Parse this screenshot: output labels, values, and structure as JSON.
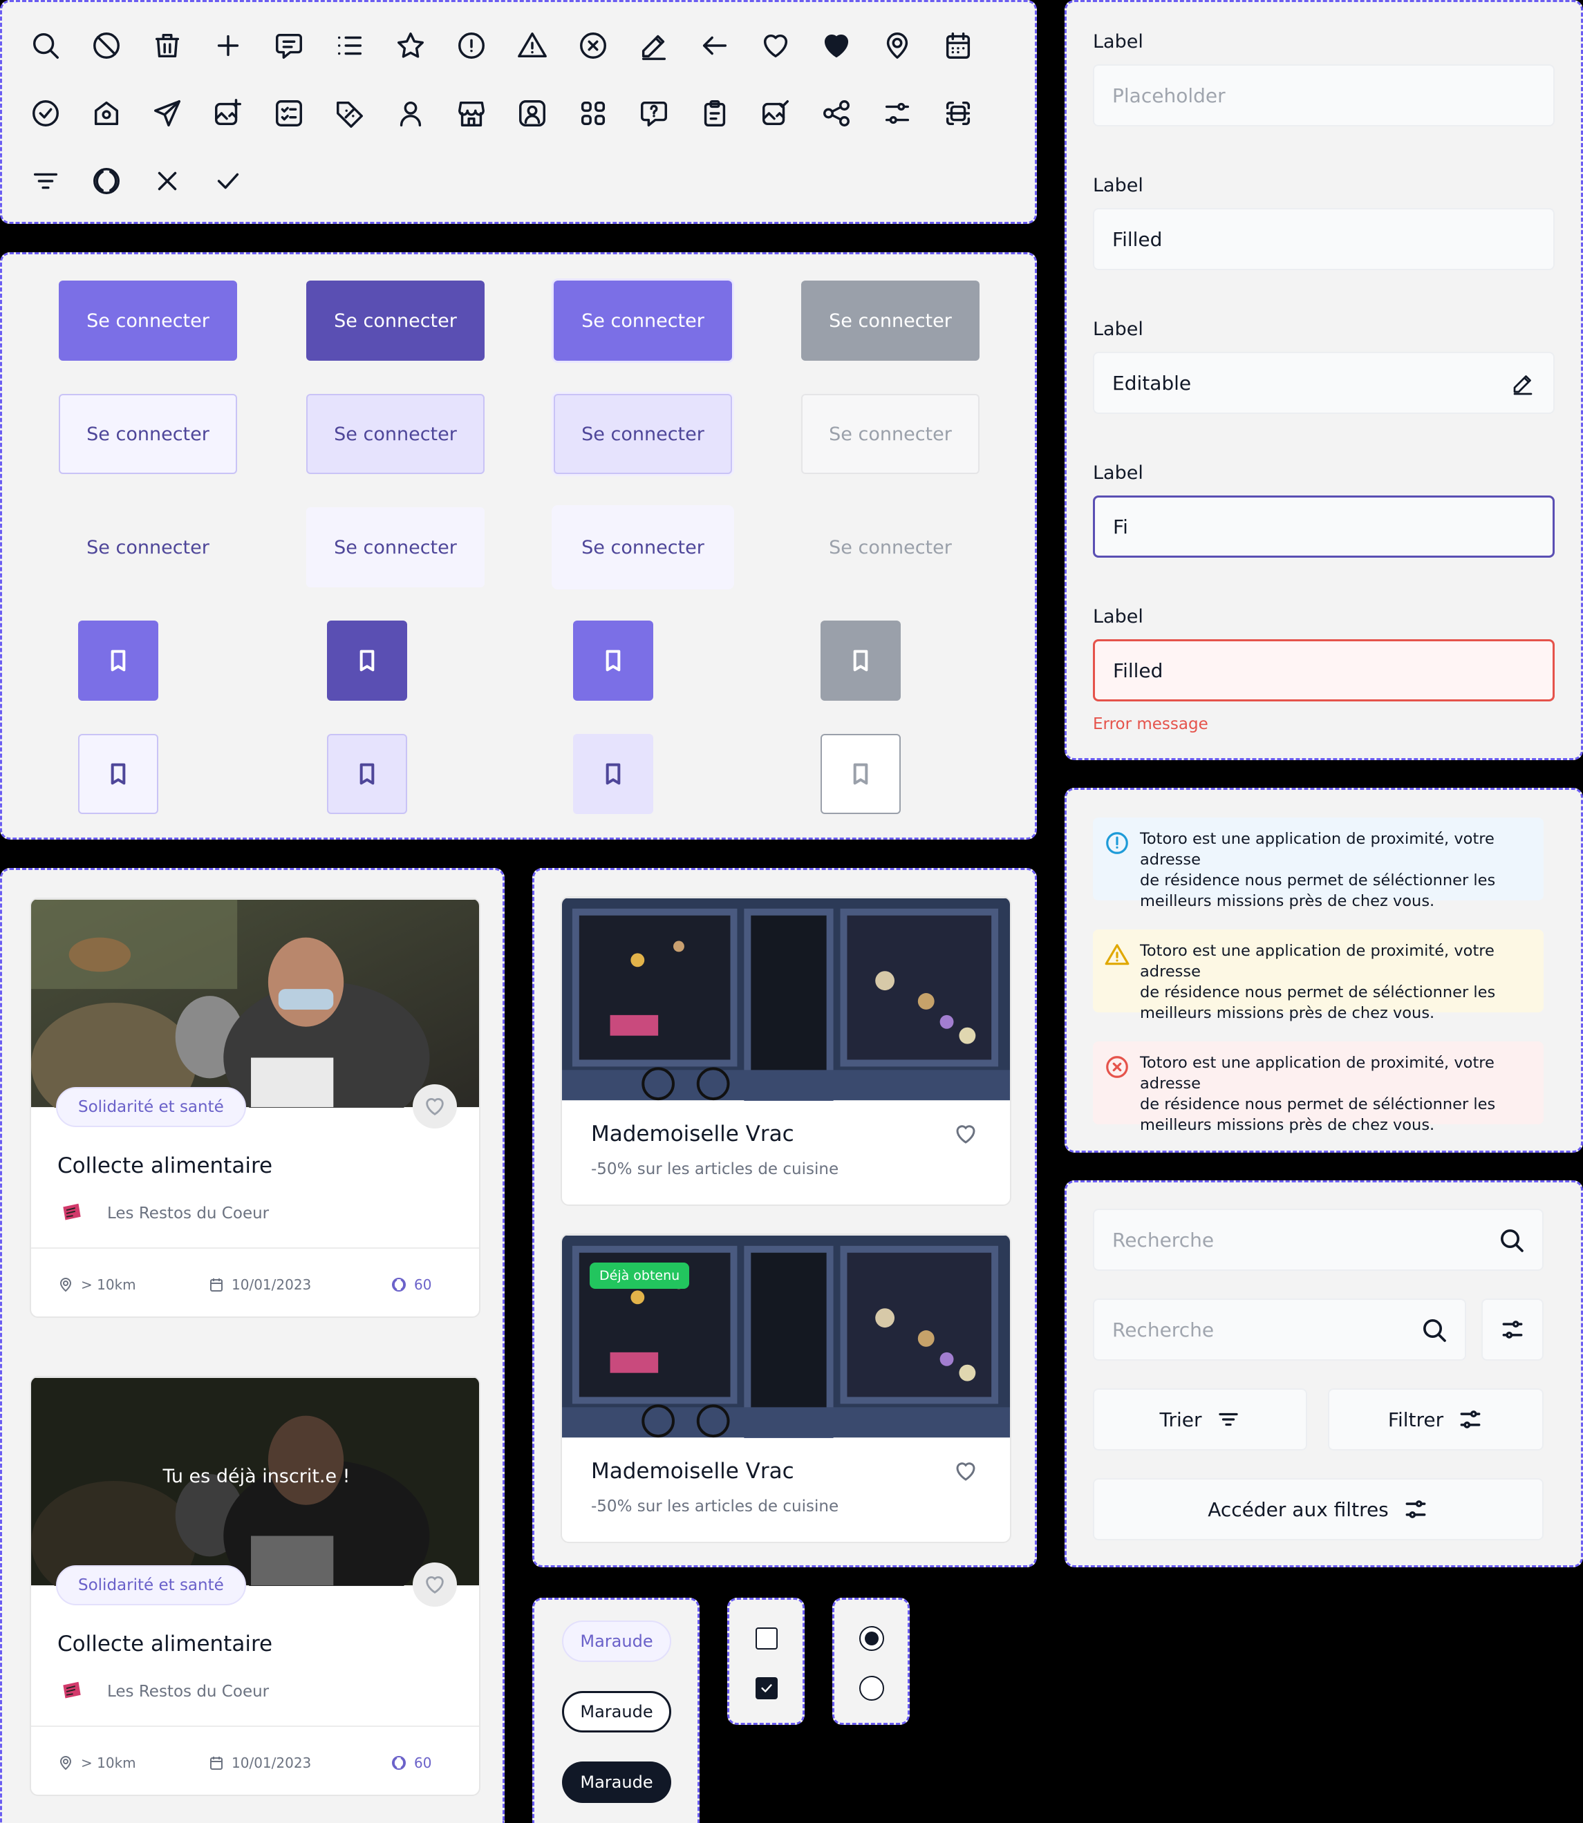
{
  "icons": {
    "row1": [
      "search-icon",
      "ban-icon",
      "trash-icon",
      "plus-icon",
      "message-icon",
      "list-icon",
      "star-icon",
      "alert-circle-icon",
      "alert-triangle-icon",
      "x-circle-icon",
      "pencil-icon",
      "arrow-left-icon",
      "heart-icon",
      "heart-filled-icon",
      "map-pin-icon",
      "calendar-icon"
    ],
    "row2": [
      "check-circle-icon",
      "home-icon",
      "send-icon",
      "photo-edit-icon",
      "checklist-icon",
      "discount-tag-icon",
      "user-icon",
      "building-store-icon",
      "user-square-icon",
      "apps-icon",
      "help-message-icon",
      "clipboard-icon",
      "photo-check-icon",
      "share-icon",
      "adjustments-icon",
      "scan-icon"
    ],
    "row3": [
      "filter-icon",
      "coin-icon",
      "close-icon",
      "check-icon"
    ]
  },
  "buttons": {
    "label": "Se connecter"
  },
  "inputs": [
    {
      "label": "Label",
      "placeholder": "Placeholder"
    },
    {
      "label": "Label",
      "value": "Filled"
    },
    {
      "label": "Label",
      "value": "Editable"
    },
    {
      "label": "Label",
      "value": "Fi"
    },
    {
      "label": "Label",
      "value": "Filled",
      "error": "Error message"
    }
  ],
  "alerts": {
    "text_line1": "Totoro est une application de proximité, votre adresse",
    "text_line2": "de résidence nous permet de séléctionner les",
    "text_line3": "meilleurs missions près de chez vous."
  },
  "mission_card": {
    "tag": "Solidarité et santé",
    "title": "Collecte alimentaire",
    "org": "Les Restos du Coeur",
    "distance": "> 10km",
    "date": "10/01/2023",
    "points": "60",
    "overlay": "Tu es déjà inscrit.e !"
  },
  "shop_card": {
    "title": "Mademoiselle Vrac",
    "subtitle": "-50% sur les articles de cuisine",
    "badge": "Déjà obtenu"
  },
  "chips": {
    "label": "Maraude"
  },
  "search": {
    "placeholder": "Recherche",
    "sort": "Trier",
    "filter": "Filtrer",
    "access_filters": "Accéder aux filtres"
  },
  "colors": {
    "primary": "#7b6fe6",
    "primary_dark": "#5a4fb3",
    "disabled": "#9aa0aa",
    "error": "#e5534b",
    "info_bg": "#eef6fd",
    "warning_bg": "#fdf8e4",
    "error_bg": "#fdf0f0"
  }
}
